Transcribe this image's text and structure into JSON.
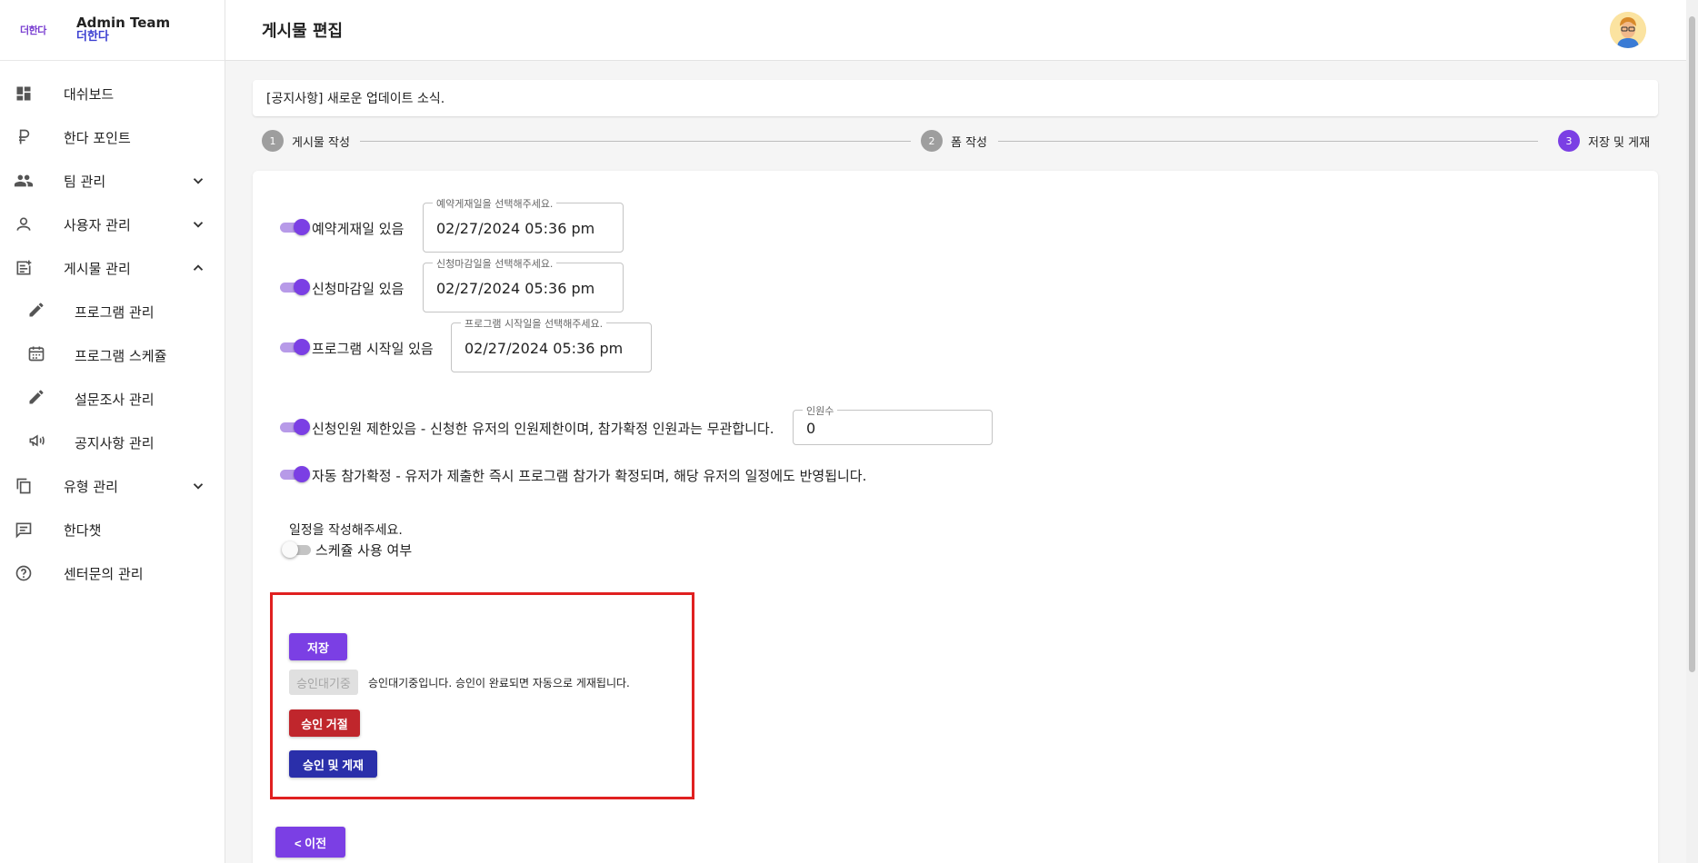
{
  "brand": {
    "logo_text": "더한다",
    "title": "Admin Team",
    "subtitle": "더한다"
  },
  "sidebar": {
    "items": [
      {
        "label": "대쉬보드",
        "icon": "dashboard-icon"
      },
      {
        "label": "한다 포인트",
        "icon": "ruble-icon"
      },
      {
        "label": "팀 관리",
        "icon": "people-icon"
      },
      {
        "label": "사용자 관리",
        "icon": "person-icon"
      },
      {
        "label": "게시물 관리",
        "icon": "post-add-icon"
      },
      {
        "label": "프로그램 관리",
        "icon": "pencil-icon"
      },
      {
        "label": "프로그램 스케쥴",
        "icon": "calendar-icon"
      },
      {
        "label": "설문조사 관리",
        "icon": "pencil-icon"
      },
      {
        "label": "공지사항 관리",
        "icon": "megaphone-icon"
      },
      {
        "label": "유형 관리",
        "icon": "copy-icon"
      },
      {
        "label": "한다챗",
        "icon": "chat-icon"
      },
      {
        "label": "센터문의 관리",
        "icon": "help-icon"
      }
    ]
  },
  "header": {
    "title": "게시물 편집"
  },
  "notice": {
    "title": "[공지사항] 새로운 업데이트 소식."
  },
  "stepper": {
    "steps": [
      {
        "num": "1",
        "label": "게시물 작성"
      },
      {
        "num": "2",
        "label": "폼 작성"
      },
      {
        "num": "3",
        "label": "저장 및 게재"
      }
    ]
  },
  "form": {
    "reserve": {
      "label": "예약게재일 있음",
      "legend": "예약게재일을 선택해주세요.",
      "value": "02/27/2024 05:36 pm"
    },
    "deadline": {
      "label": "신청마감일 있음",
      "legend": "신청마감일을 선택해주세요.",
      "value": "02/27/2024 05:36 pm"
    },
    "start": {
      "label": "프로그램 시작일 있음",
      "legend": "프로그램 시작일을 선택해주세요.",
      "value": "02/27/2024 05:36 pm"
    },
    "limit": {
      "label": "신청인원 제한있음 - 신청한 유저의 인원제한이며, 참가확정 인원과는 무관합니다.",
      "legend": "인원수",
      "value": "0"
    },
    "auto": {
      "label": "자동 참가확정 - 유저가 제출한 즉시 프로그램 참가가 확정되며, 해당 유저의 일정에도 반영됩니다."
    },
    "schedule_prompt": "일정을 작성해주세요.",
    "schedule_toggle_label": "스케쥴 사용 여부"
  },
  "actions": {
    "save": "저장",
    "pending": "승인대기중",
    "pending_message": "승인대기중입니다. 승인이 완료되면 자동으로 게재됩니다.",
    "reject": "승인 거절",
    "approve": "승인 및 게재",
    "prev": "< 이전"
  },
  "colors": {
    "accent": "#7b3fe4",
    "reject": "#c0262c",
    "approve": "#2a2faa",
    "highlight": "#e02020"
  }
}
